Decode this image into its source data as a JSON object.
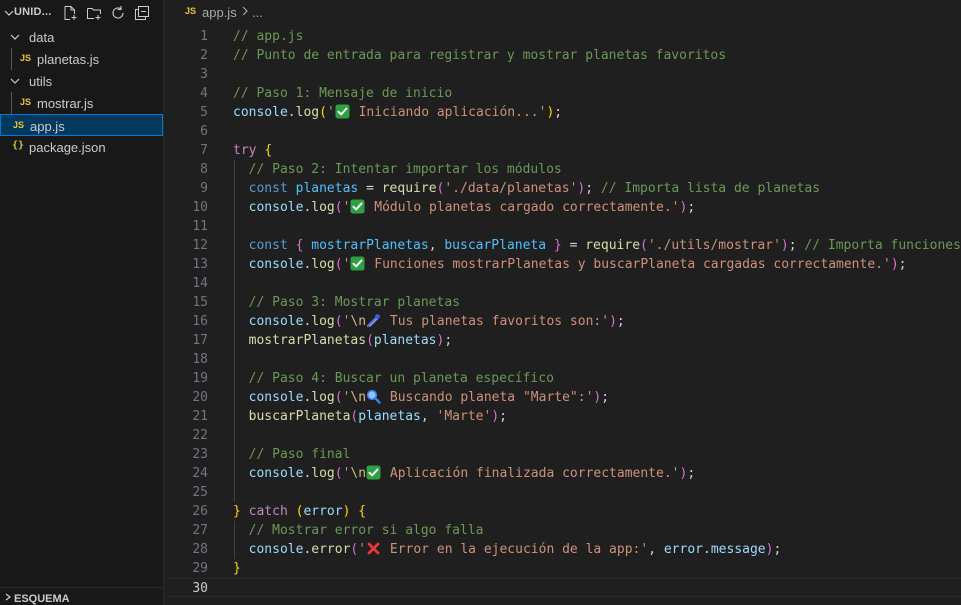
{
  "explorer": {
    "project_title": "UNID...",
    "actions": [
      "new-file-icon",
      "new-folder-icon",
      "refresh-icon",
      "collapse-all-icon"
    ],
    "tree": [
      {
        "label": "data",
        "type": "folder",
        "expanded": true,
        "depth": 0
      },
      {
        "label": "planetas.js",
        "type": "js",
        "depth": 1
      },
      {
        "label": "utils",
        "type": "folder",
        "expanded": true,
        "depth": 0
      },
      {
        "label": "mostrar.js",
        "type": "js",
        "depth": 1
      },
      {
        "label": "app.js",
        "type": "js",
        "depth": 0,
        "selected": true
      },
      {
        "label": "package.json",
        "type": "json",
        "depth": 0
      }
    ],
    "js_badge": "JS",
    "json_badge": "{}",
    "outline_title": "ESQUEMA"
  },
  "editor": {
    "breadcrumb": {
      "badge": "JS",
      "file": "app.js",
      "more": "..."
    },
    "current_line": 30,
    "lines": [
      [
        [
          "c",
          "// app.js"
        ]
      ],
      [
        [
          "c",
          "// Punto de entrada para registrar y mostrar planetas favoritos"
        ]
      ],
      [],
      [
        [
          "c",
          "// Paso 1: Mensaje de inicio"
        ]
      ],
      [
        [
          "v",
          "console"
        ],
        [
          "p",
          "."
        ],
        [
          "f",
          "log"
        ],
        [
          "b1",
          "("
        ],
        [
          "s",
          "'"
        ],
        [
          "em",
          "check"
        ],
        [
          "s",
          " Iniciando aplicación...'"
        ],
        [
          "b1",
          ")"
        ],
        [
          "p",
          ";"
        ]
      ],
      [],
      [
        [
          "k",
          "try"
        ],
        [
          "p",
          " "
        ],
        [
          "b1",
          "{"
        ]
      ],
      [
        [
          "p",
          "  "
        ],
        [
          "c",
          "// Paso 2: Intentar importar los módulos"
        ]
      ],
      [
        [
          "p",
          "  "
        ],
        [
          "d",
          "const"
        ],
        [
          "p",
          " "
        ],
        [
          "cv",
          "planetas"
        ],
        [
          "p",
          " = "
        ],
        [
          "f",
          "require"
        ],
        [
          "b2",
          "("
        ],
        [
          "s",
          "'./data/planetas'"
        ],
        [
          "b2",
          ")"
        ],
        [
          "p",
          "; "
        ],
        [
          "c",
          "// Importa lista de planetas"
        ]
      ],
      [
        [
          "p",
          "  "
        ],
        [
          "v",
          "console"
        ],
        [
          "p",
          "."
        ],
        [
          "f",
          "log"
        ],
        [
          "b2",
          "("
        ],
        [
          "s",
          "'"
        ],
        [
          "em",
          "check"
        ],
        [
          "s",
          " Módulo planetas cargado correctamente.'"
        ],
        [
          "b2",
          ")"
        ],
        [
          "p",
          ";"
        ]
      ],
      [],
      [
        [
          "p",
          "  "
        ],
        [
          "d",
          "const"
        ],
        [
          "p",
          " "
        ],
        [
          "b2",
          "{"
        ],
        [
          "p",
          " "
        ],
        [
          "cv",
          "mostrarPlanetas"
        ],
        [
          "p",
          ", "
        ],
        [
          "cv",
          "buscarPlaneta"
        ],
        [
          "p",
          " "
        ],
        [
          "b2",
          "}"
        ],
        [
          "p",
          " = "
        ],
        [
          "f",
          "require"
        ],
        [
          "b2",
          "("
        ],
        [
          "s",
          "'./utils/mostrar'"
        ],
        [
          "b2",
          ")"
        ],
        [
          "p",
          "; "
        ],
        [
          "c",
          "// Importa funciones"
        ]
      ],
      [
        [
          "p",
          "  "
        ],
        [
          "v",
          "console"
        ],
        [
          "p",
          "."
        ],
        [
          "f",
          "log"
        ],
        [
          "b2",
          "("
        ],
        [
          "s",
          "'"
        ],
        [
          "em",
          "check"
        ],
        [
          "s",
          " Funciones mostrarPlanetas y buscarPlaneta cargadas correctamente.'"
        ],
        [
          "b2",
          ")"
        ],
        [
          "p",
          ";"
        ]
      ],
      [],
      [
        [
          "p",
          "  "
        ],
        [
          "c",
          "// Paso 3: Mostrar planetas"
        ]
      ],
      [
        [
          "p",
          "  "
        ],
        [
          "v",
          "console"
        ],
        [
          "p",
          "."
        ],
        [
          "f",
          "log"
        ],
        [
          "b2",
          "("
        ],
        [
          "s",
          "'"
        ],
        [
          "e",
          "\\n"
        ],
        [
          "em",
          "comet"
        ],
        [
          "s",
          " Tus planetas favoritos son:'"
        ],
        [
          "b2",
          ")"
        ],
        [
          "p",
          ";"
        ]
      ],
      [
        [
          "p",
          "  "
        ],
        [
          "f",
          "mostrarPlanetas"
        ],
        [
          "b2",
          "("
        ],
        [
          "v",
          "planetas"
        ],
        [
          "b2",
          ")"
        ],
        [
          "p",
          ";"
        ]
      ],
      [],
      [
        [
          "p",
          "  "
        ],
        [
          "c",
          "// Paso 4: Buscar un planeta específico"
        ]
      ],
      [
        [
          "p",
          "  "
        ],
        [
          "v",
          "console"
        ],
        [
          "p",
          "."
        ],
        [
          "f",
          "log"
        ],
        [
          "b2",
          "("
        ],
        [
          "s",
          "'"
        ],
        [
          "e",
          "\\n"
        ],
        [
          "em",
          "magnifier"
        ],
        [
          "s",
          " Buscando planeta \"Marte\":'"
        ],
        [
          "b2",
          ")"
        ],
        [
          "p",
          ";"
        ]
      ],
      [
        [
          "p",
          "  "
        ],
        [
          "f",
          "buscarPlaneta"
        ],
        [
          "b2",
          "("
        ],
        [
          "v",
          "planetas"
        ],
        [
          "p",
          ", "
        ],
        [
          "s",
          "'Marte'"
        ],
        [
          "b2",
          ")"
        ],
        [
          "p",
          ";"
        ]
      ],
      [],
      [
        [
          "p",
          "  "
        ],
        [
          "c",
          "// Paso final"
        ]
      ],
      [
        [
          "p",
          "  "
        ],
        [
          "v",
          "console"
        ],
        [
          "p",
          "."
        ],
        [
          "f",
          "log"
        ],
        [
          "b2",
          "("
        ],
        [
          "s",
          "'"
        ],
        [
          "e",
          "\\n"
        ],
        [
          "em",
          "check"
        ],
        [
          "s",
          " Aplicación finalizada correctamente.'"
        ],
        [
          "b2",
          ")"
        ],
        [
          "p",
          ";"
        ]
      ],
      [],
      [
        [
          "b1",
          "}"
        ],
        [
          "p",
          " "
        ],
        [
          "k",
          "catch"
        ],
        [
          "p",
          " "
        ],
        [
          "b1",
          "("
        ],
        [
          "v",
          "error"
        ],
        [
          "b1",
          ")"
        ],
        [
          "p",
          " "
        ],
        [
          "b1",
          "{"
        ]
      ],
      [
        [
          "p",
          "  "
        ],
        [
          "c",
          "// Mostrar error si algo falla"
        ]
      ],
      [
        [
          "p",
          "  "
        ],
        [
          "v",
          "console"
        ],
        [
          "p",
          "."
        ],
        [
          "f",
          "error"
        ],
        [
          "b2",
          "("
        ],
        [
          "s",
          "'"
        ],
        [
          "em",
          "cross"
        ],
        [
          "s",
          " Error en la ejecución de la app:'"
        ],
        [
          "p",
          ", "
        ],
        [
          "v",
          "error"
        ],
        [
          "p",
          "."
        ],
        [
          "v",
          "message"
        ],
        [
          "b2",
          ")"
        ],
        [
          "p",
          ";"
        ]
      ],
      [
        [
          "b1",
          "}"
        ]
      ],
      []
    ]
  }
}
